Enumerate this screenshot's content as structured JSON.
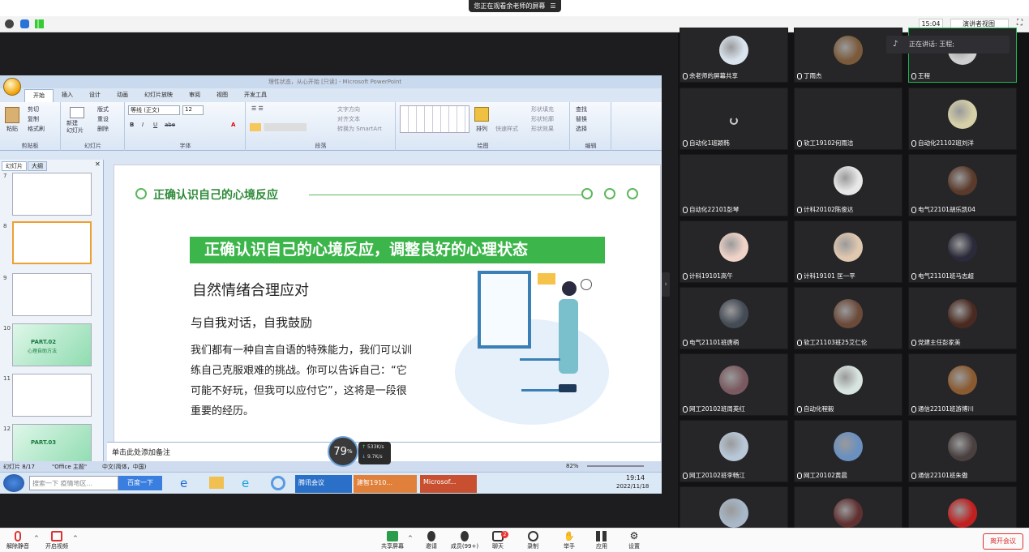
{
  "notice": {
    "text": "您正在观看余老师的屏幕"
  },
  "topbar": {
    "time": "15:04",
    "view_mode": "演讲者视图"
  },
  "ppt": {
    "window_title": "理性状态，从心开始 [只读] - Microsoft PowerPoint",
    "tabs": [
      "开始",
      "插入",
      "设计",
      "动画",
      "幻灯片放映",
      "审阅",
      "视图",
      "开发工具"
    ],
    "groups": {
      "clipboard": {
        "label": "剪贴板",
        "paste": "粘贴",
        "cut": "剪切",
        "copy": "复制",
        "format": "格式刷"
      },
      "slides": {
        "label": "幻灯片",
        "new": "新建\n幻灯片",
        "layout": "版式",
        "reset": "重设",
        "delete": "删除"
      },
      "font": {
        "label": "字体",
        "font_name": "等线 (正文)",
        "font_size": "12"
      },
      "paragraph": {
        "label": "段落",
        "text_dir": "文字方向",
        "align_text": "对齐文本",
        "smartart": "转换为 SmartArt"
      },
      "drawing": {
        "label": "绘图",
        "arrange": "排列",
        "quick_styles": "快速样式",
        "fill": "形状填充",
        "outline": "形状轮廓",
        "effects": "形状效果"
      },
      "editing": {
        "label": "编辑",
        "find": "查找",
        "replace": "替换",
        "select": "选择"
      }
    },
    "pane_tabs": [
      "幻灯片",
      "大纲"
    ],
    "thumbs": [
      {
        "num": "7"
      },
      {
        "num": "8"
      },
      {
        "num": "9"
      },
      {
        "num": "10",
        "t1": "PART.02",
        "t2": "心理自助方法"
      },
      {
        "num": "11"
      },
      {
        "num": "12",
        "t1": "PART.03"
      }
    ],
    "slide": {
      "header": "正确认识自己的心境反应",
      "banner": "正确认识自己的心境反应，调整良好的心理状态",
      "h1": "自然情绪合理应对",
      "h2": "与自我对话，自我鼓励",
      "p1": "我们都有一种自言自语的特殊能力，我们可以训",
      "p2": "练自己克服艰难的挑战。你可以告诉自己：“它",
      "p3": "可能不好玩，但我可以应付它”，这将是一段很",
      "p4": "重要的经历。"
    },
    "notes": "单击此处添加备注",
    "status": {
      "slide_pos": "幻灯片 8/17",
      "theme": "\"Office 主题\"",
      "lang": "中文(简体，中国)",
      "zoom": "82%"
    },
    "taskbar": {
      "search": "搜索一下",
      "search_hint": "疫情地区...",
      "baidu": "百度一下",
      "apps": [
        "腾讯会议",
        "建智1910...",
        "Microsof..."
      ],
      "clock_time": "19:14",
      "clock_date": "2022/11/18"
    }
  },
  "gauge": {
    "percent": "79",
    "unit": "%",
    "up": "533K/s",
    "down": "9.7K/s"
  },
  "speaking": {
    "label": "正在讲话: 王程;"
  },
  "participants": [
    {
      "name": "余老师的屏幕共享",
      "color": "#d9e4ee"
    },
    {
      "name": "丁雨杰",
      "color": "#7a5a3a"
    },
    {
      "name": "王程",
      "color": "#cfcfcf"
    },
    {
      "name": "自动化1班颖韩",
      "color": ""
    },
    {
      "name": "软工19102何雨洁",
      "color": ""
    },
    {
      "name": "自动化21102班刘洋",
      "color": "#d6d0a8"
    },
    {
      "name": "自动化22101彭琴",
      "color": ""
    },
    {
      "name": "计科20102陈俊达",
      "color": "#e8e8e8"
    },
    {
      "name": "电气22101胡乐凯04",
      "color": "#5a3a2a"
    },
    {
      "name": "计科19101高午",
      "color": "#f0d3c8"
    },
    {
      "name": "计科19101 匡一平",
      "color": "#e0c8b0"
    },
    {
      "name": "电气21101班马志超",
      "color": "#2a2a3a"
    },
    {
      "name": "电气21101班唐萌",
      "color": "#444b55"
    },
    {
      "name": "软工21103班25艾仁伦",
      "color": "#6b4a3a"
    },
    {
      "name": "党建主任彭家美",
      "color": "#4a2a20"
    },
    {
      "name": "网工20102班周英红",
      "color": "#7a5a60"
    },
    {
      "name": "自动化程毅",
      "color": "#d8e4e0"
    },
    {
      "name": "通信22101班游博川",
      "color": "#8a5a30"
    },
    {
      "name": "网工20102班李畅江",
      "color": "#b8c8d8"
    },
    {
      "name": "网工20102黄晨",
      "color": "#6a90c0"
    },
    {
      "name": "通信22101班朱傲",
      "color": "#4a4040"
    },
    {
      "name": "",
      "color": "#a8b8c8"
    },
    {
      "name": "",
      "color": "#603030"
    },
    {
      "name": "",
      "color": "#c02020"
    }
  ],
  "toolbar": {
    "mute": "解除静音",
    "video": "开启视频",
    "share": "共享屏幕",
    "invite": "邀请",
    "members": "成员(99+)",
    "chat": "聊天",
    "chat_badge": "2",
    "record": "录制",
    "hand": "举手",
    "apps": "应用",
    "settings": "设置",
    "leave": "离开会议"
  }
}
